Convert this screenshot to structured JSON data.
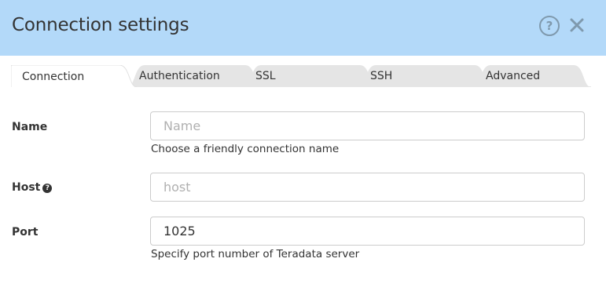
{
  "dialog": {
    "title": "Connection settings"
  },
  "tabs": [
    {
      "label": "Connection",
      "active": true
    },
    {
      "label": "Authentication",
      "active": false
    },
    {
      "label": "SSL",
      "active": false
    },
    {
      "label": "SSH",
      "active": false
    },
    {
      "label": "Advanced",
      "active": false
    }
  ],
  "form": {
    "name": {
      "label": "Name",
      "value": "",
      "placeholder": "Name",
      "help": "Choose a friendly connection name"
    },
    "host": {
      "label": "Host",
      "info_icon": "question-circle-icon",
      "value": "",
      "placeholder": "host"
    },
    "port": {
      "label": "Port",
      "value": "1025",
      "placeholder": "",
      "help": "Specify port number of Teradata server"
    }
  },
  "colors": {
    "header_bg": "#b3d9f9",
    "active_tab_bg": "#ffffff",
    "inactive_tab_bg": "#e5e5e5",
    "icon_color": "#7f99ad"
  },
  "icons": {
    "help": "question-circle-icon",
    "close": "close-icon"
  }
}
